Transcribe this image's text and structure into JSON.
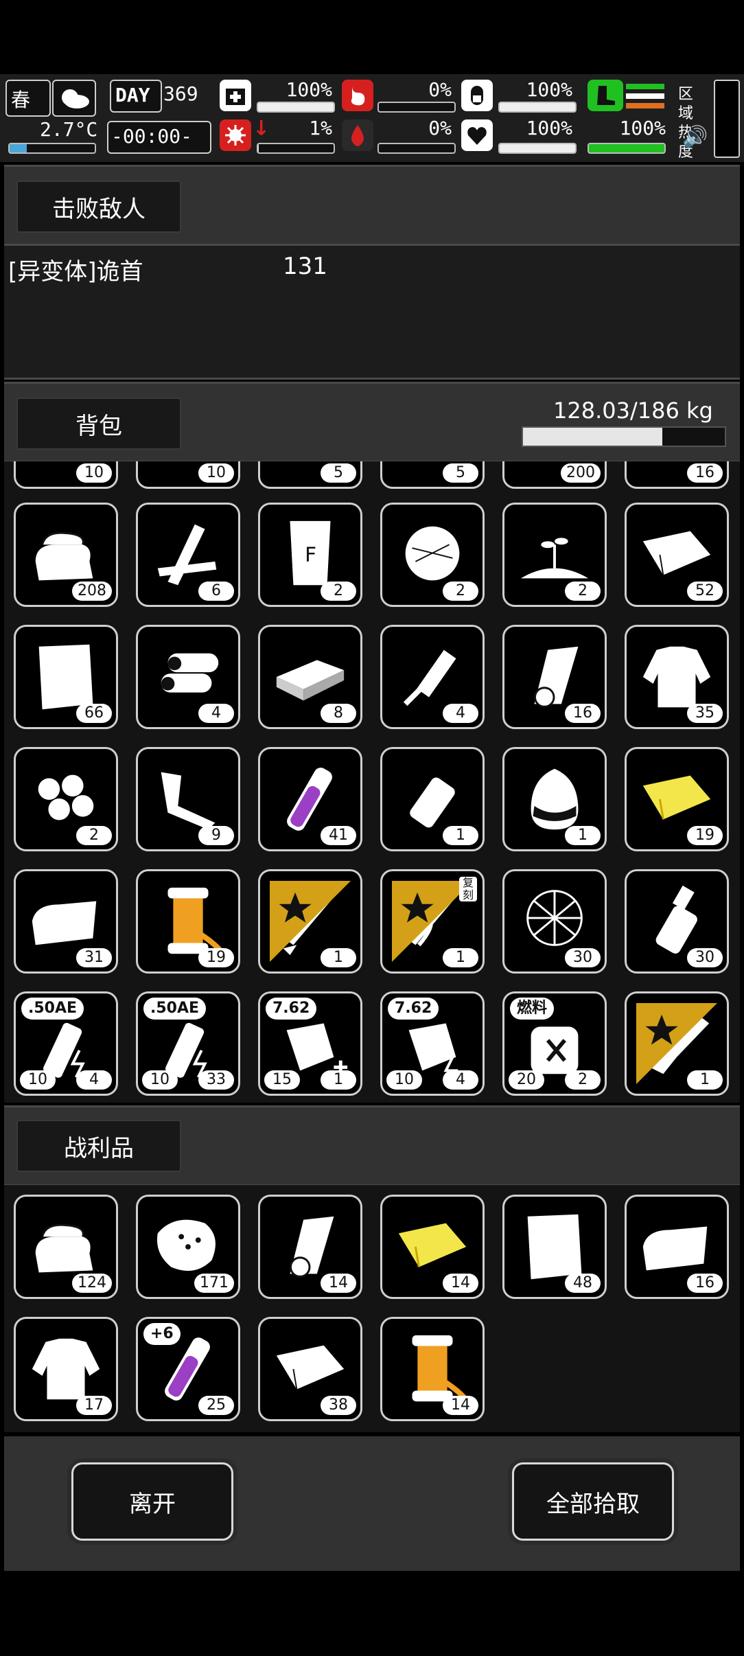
{
  "hud": {
    "season": "春",
    "temperature": "2.7°C",
    "day_label": "DAY",
    "day_number": "369",
    "clock": "-00:00-",
    "stats": {
      "health": "100%",
      "hunger": "0%",
      "pressure": "100%",
      "infection": "1%",
      "bleeding": "0%",
      "mood": "100%",
      "stamina": "100%"
    },
    "zone_heat_label": "区域热度"
  },
  "defeated": {
    "header": "击败敌人",
    "entries": [
      {
        "name": "[异变体]诡首",
        "value": "131"
      }
    ]
  },
  "backpack": {
    "header": "背包",
    "weight": "128.03/186 kg",
    "weight_fraction": 0.69,
    "partial_row": [
      "10",
      "10",
      "5",
      "5",
      "200",
      "16"
    ],
    "items": [
      {
        "icon": "cloth-pile-icon",
        "count": "208"
      },
      {
        "icon": "wood-planks-icon",
        "count": "6"
      },
      {
        "icon": "fertilizer-bag-icon",
        "count": "2"
      },
      {
        "icon": "fiber-bundle-icon",
        "count": "2"
      },
      {
        "icon": "sapling-icon",
        "count": "2"
      },
      {
        "icon": "folded-sheet-icon",
        "count": "52"
      },
      {
        "icon": "paper-sheet-icon",
        "count": "66"
      },
      {
        "icon": "logs-icon",
        "count": "4"
      },
      {
        "icon": "brick-icon",
        "count": "8"
      },
      {
        "icon": "grater-tool-icon",
        "count": "4"
      },
      {
        "icon": "rolled-cloth-icon",
        "count": "16"
      },
      {
        "icon": "torn-shirt-icon",
        "count": "35"
      },
      {
        "icon": "cotton-balls-icon",
        "count": "2"
      },
      {
        "icon": "scrap-parts-icon",
        "count": "9"
      },
      {
        "icon": "purple-potion-vial-icon",
        "count": "41"
      },
      {
        "icon": "bottle-icon",
        "count": "1"
      },
      {
        "icon": "water-bag-icon",
        "count": "1"
      },
      {
        "icon": "yellow-cloth-icon",
        "count": "19"
      },
      {
        "icon": "towel-icon",
        "count": "31"
      },
      {
        "icon": "thread-spool-icon",
        "count": "19"
      },
      {
        "icon": "sword-icon",
        "count": "1",
        "star": true
      },
      {
        "icon": "vine-sword-icon",
        "count": "1",
        "star": true,
        "tag_side": "复刻"
      },
      {
        "icon": "net-icon",
        "count": "30"
      },
      {
        "icon": "spray-bottle-icon",
        "count": "30"
      },
      {
        "icon": "battery-icon",
        "count": "4",
        "count_left": "10",
        "tag": ".50AE"
      },
      {
        "icon": "battery-water-icon",
        "count": "33",
        "count_left": "10",
        "tag": ".50AE"
      },
      {
        "icon": "ammo-pack-plus-icon",
        "count": "1",
        "count_left": "15",
        "tag": "7.62"
      },
      {
        "icon": "ammo-pack-icon",
        "count": "4",
        "count_left": "10",
        "tag": "7.62"
      },
      {
        "icon": "fuel-canister-icon",
        "count": "2",
        "count_left": "20",
        "tag": "燃料"
      },
      {
        "icon": "chainsaw-icon",
        "count": "1",
        "star": true
      }
    ]
  },
  "loot": {
    "header": "战利品",
    "items": [
      {
        "icon": "cloth-pile-icon",
        "count": "124"
      },
      {
        "icon": "meat-chunk-icon",
        "count": "171"
      },
      {
        "icon": "rolled-cloth-icon",
        "count": "14"
      },
      {
        "icon": "yellow-cloth-icon",
        "count": "14"
      },
      {
        "icon": "paper-sheet-icon",
        "count": "48"
      },
      {
        "icon": "towel-icon",
        "count": "16"
      },
      {
        "icon": "torn-shirt-icon",
        "count": "17"
      },
      {
        "icon": "purple-potion-vial-icon",
        "count": "25",
        "tag": "+6"
      },
      {
        "icon": "folded-sheet-icon",
        "count": "38"
      },
      {
        "icon": "thread-spool-icon",
        "count": "14"
      }
    ]
  },
  "actions": {
    "leave": "离开",
    "take_all": "全部拾取"
  },
  "colors": {
    "accent_gold": "#d4a017",
    "accent_green": "#21c021",
    "danger_red": "#d62020"
  }
}
